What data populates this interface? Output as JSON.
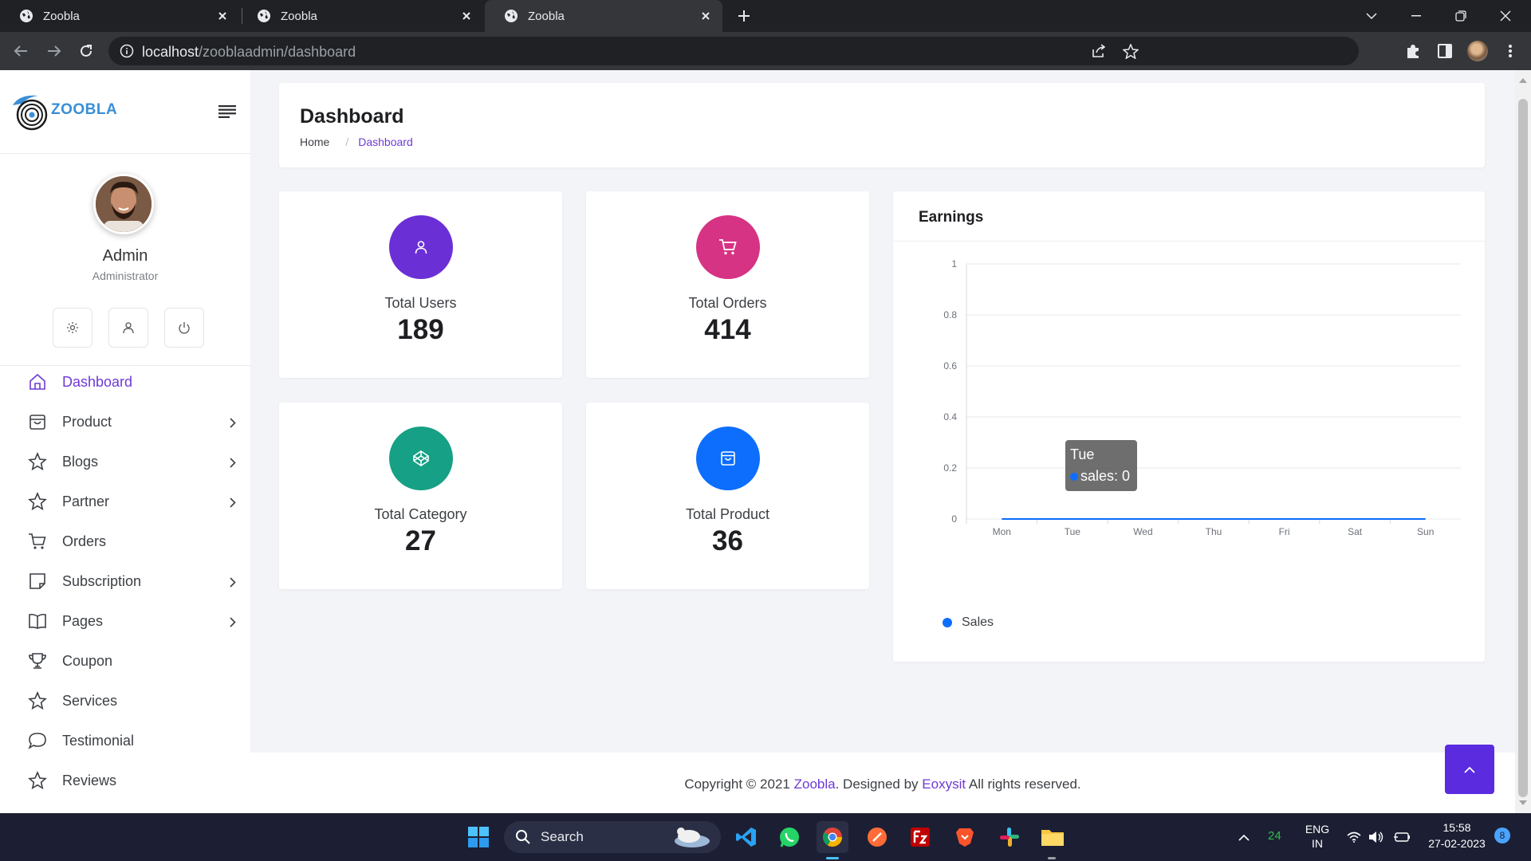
{
  "browser": {
    "tabs": [
      {
        "title": "Zoobla",
        "active": false
      },
      {
        "title": "Zoobla",
        "active": false
      },
      {
        "title": "Zoobla",
        "active": true
      }
    ],
    "url_host": "localhost",
    "url_path": "/zooblaadmin/dashboard"
  },
  "sidebar": {
    "logo_text": "ZOOBLA",
    "admin_name": "Admin",
    "admin_role": "Administrator",
    "nav": [
      {
        "label": "Dashboard",
        "icon": "home-icon",
        "has_submenu": false,
        "active": true
      },
      {
        "label": "Product",
        "icon": "bag-icon",
        "has_submenu": true,
        "active": false
      },
      {
        "label": "Blogs",
        "icon": "star-icon",
        "has_submenu": true,
        "active": false
      },
      {
        "label": "Partner",
        "icon": "star-icon",
        "has_submenu": true,
        "active": false
      },
      {
        "label": "Orders",
        "icon": "cart-icon",
        "has_submenu": false,
        "active": false
      },
      {
        "label": "Subscription",
        "icon": "note-icon",
        "has_submenu": true,
        "active": false
      },
      {
        "label": "Pages",
        "icon": "book-icon",
        "has_submenu": true,
        "active": false
      },
      {
        "label": "Coupon",
        "icon": "trophy-icon",
        "has_submenu": false,
        "active": false
      },
      {
        "label": "Services",
        "icon": "star-icon",
        "has_submenu": false,
        "active": false
      },
      {
        "label": "Testimonial",
        "icon": "chat-icon",
        "has_submenu": false,
        "active": false
      },
      {
        "label": "Reviews",
        "icon": "star-icon",
        "has_submenu": false,
        "active": false
      }
    ]
  },
  "header": {
    "title": "Dashboard",
    "breadcrumb_home": "Home",
    "breadcrumb_sep": "/",
    "breadcrumb_current": "Dashboard"
  },
  "stats": [
    {
      "label": "Total Users",
      "value": "189",
      "color": "#6b2fd6",
      "icon": "user-icon"
    },
    {
      "label": "Total Orders",
      "value": "414",
      "color": "#d63384",
      "icon": "cart-icon"
    },
    {
      "label": "Total Category",
      "value": "27",
      "color": "#16a085",
      "icon": "codepen-icon"
    },
    {
      "label": "Total Product",
      "value": "36",
      "color": "#0d6efd",
      "icon": "bag-icon"
    }
  ],
  "earnings": {
    "title": "Earnings",
    "tooltip_day": "Tue",
    "tooltip_value": "sales: 0"
  },
  "chart_data": {
    "type": "line",
    "title": "Earnings",
    "categories": [
      "Mon",
      "Tue",
      "Wed",
      "Thu",
      "Fri",
      "Sat",
      "Sun"
    ],
    "series": [
      {
        "name": "Sales",
        "values": [
          0,
          0,
          0,
          0,
          0,
          0,
          0
        ],
        "color": "#0d6efd"
      }
    ],
    "yticks": [
      "0",
      "0.2",
      "0.4",
      "0.6",
      "0.8",
      "1"
    ],
    "ylim": [
      0,
      1
    ],
    "grid": true,
    "legend": "bottom-left"
  },
  "footer": {
    "prefix": "Copyright © 2021",
    "brand": "Zoobla",
    "middle": ". Designed by",
    "designer": "Eoxysit",
    "suffix": "All rights reserved."
  },
  "taskbar": {
    "search_label": "Search",
    "weather_temp": "24",
    "lang_line1": "ENG",
    "lang_line2": "IN",
    "time": "15:58",
    "date": "27-02-2023",
    "notification_count": "8"
  }
}
